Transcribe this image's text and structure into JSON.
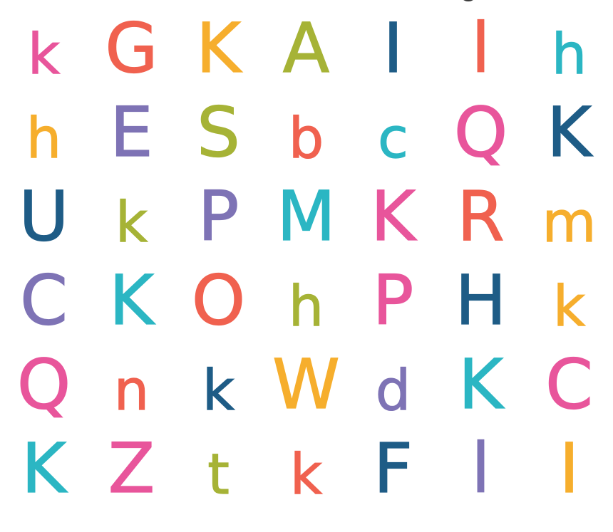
{
  "palette": {
    "pink": "#e8559b",
    "coral": "#f0614f",
    "orange": "#f6ae2d",
    "olive": "#a6b336",
    "navy": "#1e5c86",
    "teal": "#2bb6c3",
    "purple": "#7e73b5"
  },
  "grid": {
    "rows": [
      [
        {
          "char": "k",
          "case": "lower",
          "color": "#e8559b"
        },
        {
          "char": "G",
          "case": "upper",
          "color": "#f0614f"
        },
        {
          "char": "K",
          "case": "upper",
          "color": "#f6ae2d"
        },
        {
          "char": "A",
          "case": "upper",
          "color": "#a6b336"
        },
        {
          "char": "I",
          "case": "upper",
          "color": "#1e5c86"
        },
        {
          "char": "l",
          "case": "upper",
          "color": "#f0614f"
        },
        {
          "char": "h",
          "case": "lower",
          "color": "#2bb6c3"
        }
      ],
      [
        {
          "char": "h",
          "case": "lower",
          "color": "#f6ae2d"
        },
        {
          "char": "E",
          "case": "upper",
          "color": "#7e73b5"
        },
        {
          "char": "S",
          "case": "upper",
          "color": "#a6b336"
        },
        {
          "char": "b",
          "case": "lower",
          "color": "#f0614f"
        },
        {
          "char": "c",
          "case": "lower",
          "color": "#2bb6c3"
        },
        {
          "char": "Q",
          "case": "upper",
          "color": "#e8559b"
        },
        {
          "char": "K",
          "case": "upper",
          "color": "#1e5c86"
        }
      ],
      [
        {
          "char": "U",
          "case": "upper",
          "color": "#1e5c86"
        },
        {
          "char": "k",
          "case": "lower",
          "color": "#a6b336"
        },
        {
          "char": "P",
          "case": "upper",
          "color": "#7e73b5"
        },
        {
          "char": "M",
          "case": "upper",
          "color": "#2bb6c3"
        },
        {
          "char": "K",
          "case": "upper",
          "color": "#e8559b"
        },
        {
          "char": "R",
          "case": "upper",
          "color": "#f0614f"
        },
        {
          "char": "m",
          "case": "lower",
          "color": "#f6ae2d"
        }
      ],
      [
        {
          "char": "C",
          "case": "upper",
          "color": "#7e73b5"
        },
        {
          "char": "K",
          "case": "upper",
          "color": "#2bb6c3"
        },
        {
          "char": "O",
          "case": "upper",
          "color": "#f0614f"
        },
        {
          "char": "h",
          "case": "lower",
          "color": "#a6b336"
        },
        {
          "char": "P",
          "case": "upper",
          "color": "#e8559b"
        },
        {
          "char": "H",
          "case": "upper",
          "color": "#1e5c86"
        },
        {
          "char": "k",
          "case": "lower",
          "color": "#f6ae2d"
        }
      ],
      [
        {
          "char": "Q",
          "case": "upper",
          "color": "#e8559b"
        },
        {
          "char": "n",
          "case": "lower",
          "color": "#f0614f"
        },
        {
          "char": "k",
          "case": "lower",
          "color": "#1e5c86"
        },
        {
          "char": "W",
          "case": "upper",
          "color": "#f6ae2d"
        },
        {
          "char": "d",
          "case": "lower",
          "color": "#7e73b5"
        },
        {
          "char": "K",
          "case": "upper",
          "color": "#2bb6c3"
        },
        {
          "char": "C",
          "case": "upper",
          "color": "#e8559b"
        }
      ],
      [
        {
          "char": "K",
          "case": "upper",
          "color": "#2bb6c3"
        },
        {
          "char": "Z",
          "case": "upper",
          "color": "#e8559b"
        },
        {
          "char": "t",
          "case": "lower",
          "color": "#a6b336"
        },
        {
          "char": "k",
          "case": "lower",
          "color": "#f0614f"
        },
        {
          "char": "F",
          "case": "upper",
          "color": "#1e5c86"
        },
        {
          "char": "l",
          "case": "upper",
          "color": "#7e73b5"
        },
        {
          "char": "I",
          "case": "upper",
          "color": "#f6ae2d"
        }
      ]
    ]
  }
}
